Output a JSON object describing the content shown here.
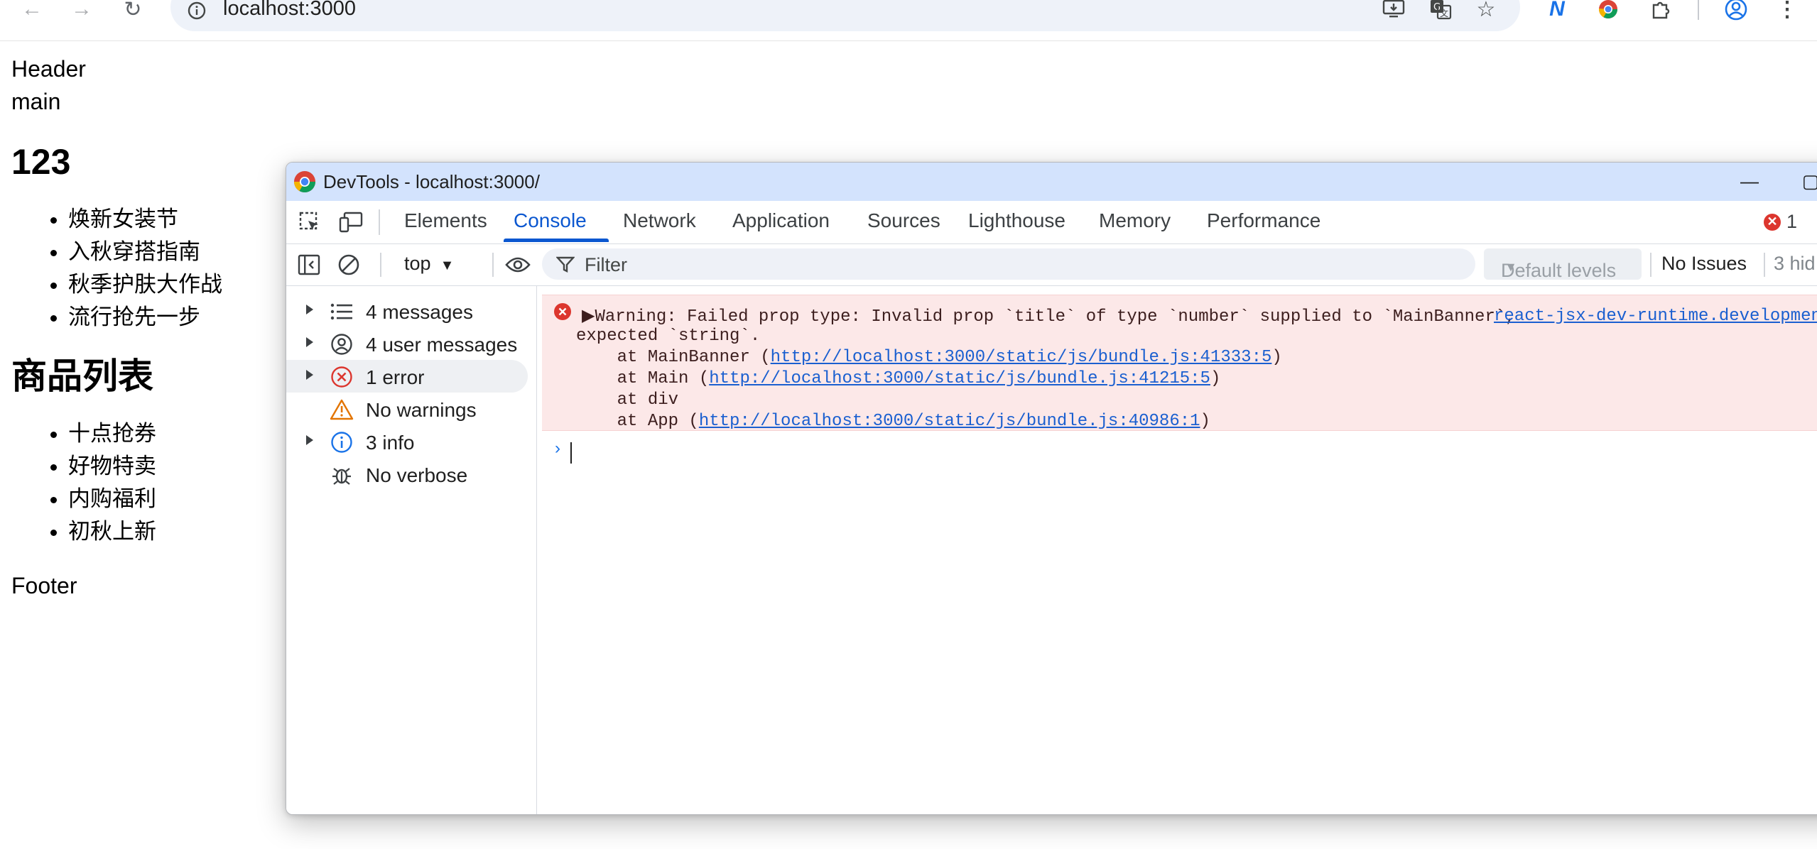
{
  "browser": {
    "url": "localhost:3000",
    "nav": {
      "back": "←",
      "forward": "→",
      "reload": "↻"
    },
    "toolbar_icons": [
      "install-app-icon",
      "translate-icon",
      "bookmark-star-icon",
      "extension-n-icon",
      "chrome-extension-icon",
      "puzzle-extensions-icon",
      "profile-icon",
      "more-menu-icon"
    ]
  },
  "page": {
    "header": "Header",
    "main": "main",
    "heading1": "123",
    "list1": [
      "焕新女装节",
      "入秋穿搭指南",
      "秋季护肤大作战",
      "流行抢先一步"
    ],
    "heading2": "商品列表",
    "list2": [
      "十点抢券",
      "好物特卖",
      "内购福利",
      "初秋上新"
    ],
    "footer": "Footer"
  },
  "devtools": {
    "window_title": "DevTools - localhost:3000/",
    "window_buttons": {
      "minimize": "—",
      "maximize": "▢"
    },
    "tabs": [
      "Elements",
      "Console",
      "Network",
      "Application",
      "Sources",
      "Lighthouse",
      "Memory",
      "Performance"
    ],
    "active_tab": "Console",
    "error_badge_count": "1",
    "filterbar": {
      "context": "top",
      "filter_placeholder": "Filter",
      "levels": "Default levels",
      "issues": "No Issues",
      "hidden": "3 hid"
    },
    "sidebar": [
      {
        "label": "4 messages",
        "icon": "list-icon",
        "expandable": true
      },
      {
        "label": "4 user messages",
        "icon": "user-icon",
        "expandable": true
      },
      {
        "label": "1 error",
        "icon": "error-icon",
        "expandable": true,
        "selected": true
      },
      {
        "label": "No warnings",
        "icon": "warning-icon",
        "expandable": false
      },
      {
        "label": "3 info",
        "icon": "info-icon",
        "expandable": true
      },
      {
        "label": "No verbose",
        "icon": "bug-icon",
        "expandable": false
      }
    ],
    "console": {
      "error": {
        "line1": "▶Warning: Failed prop type: Invalid prop `title` of type `number` supplied to `MainBanner`,",
        "line2": "expected `string`.",
        "stack": [
          {
            "prefix": "    at MainBanner (",
            "link": "http://localhost:3000/static/js/bundle.js:41333:5",
            "suffix": ")"
          },
          {
            "prefix": "    at Main (",
            "link": "http://localhost:3000/static/js/bundle.js:41215:5",
            "suffix": ")"
          },
          {
            "prefix": "    at div",
            "link": "",
            "suffix": ""
          },
          {
            "prefix": "    at App (",
            "link": "http://localhost:3000/static/js/bundle.js:40986:1",
            "suffix": ")"
          }
        ],
        "source": "react-jsx-dev-runtime.development.js"
      },
      "prompt": "›"
    }
  }
}
